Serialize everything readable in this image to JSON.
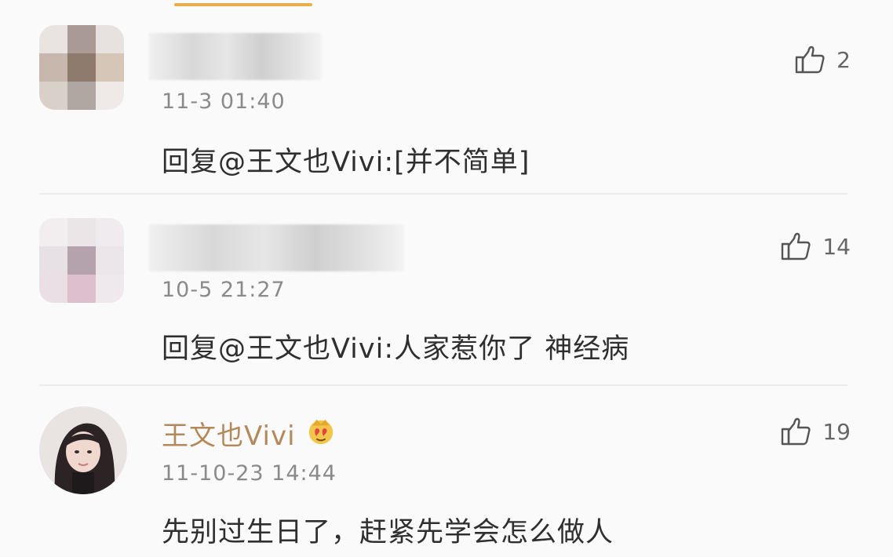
{
  "comments": [
    {
      "timestamp": "11-3 01:40",
      "text": "回复@王文也Vivi:[并不简单]",
      "likes": "2"
    },
    {
      "timestamp": "10-5 21:27",
      "text": "回复@王文也Vivi:人家惹你了 神经病",
      "likes": "14"
    },
    {
      "username": "王文也Vivi",
      "badge_icon": "emoji-badge-icon",
      "timestamp": "11-10-23 14:44",
      "text": "先别过生日了，赶紧先学会怎么做人",
      "likes": "19"
    }
  ],
  "colors": {
    "accent": "#e8b04a",
    "username": "#b3885a",
    "timestamp": "#8a8a8a"
  }
}
